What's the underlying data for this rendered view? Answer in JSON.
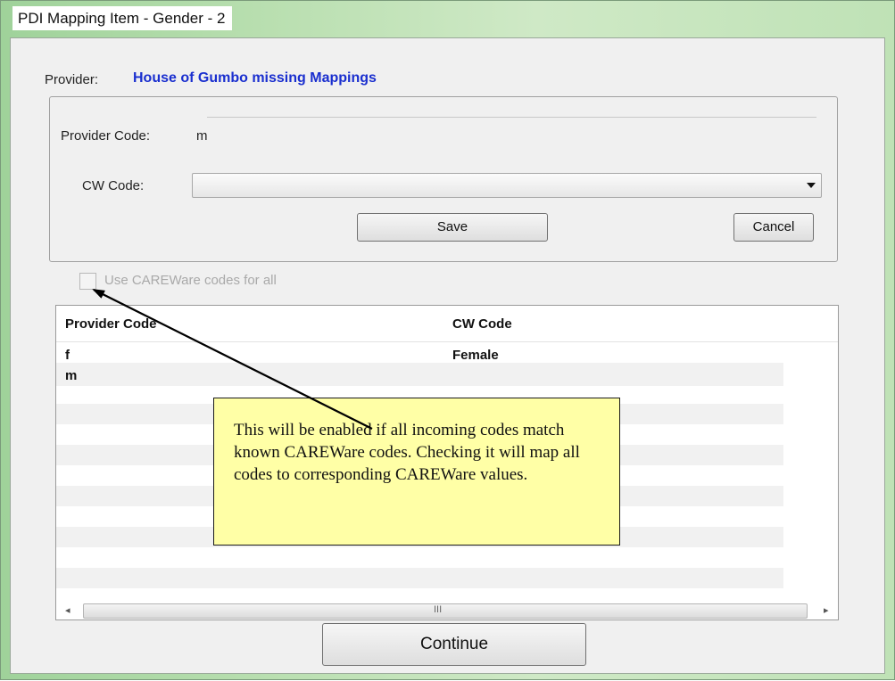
{
  "window": {
    "title": "PDI Mapping Item - Gender - 2"
  },
  "provider": {
    "label": "Provider:",
    "name": "House of Gumbo missing Mappings"
  },
  "form": {
    "provider_code_label": "Provider Code:",
    "provider_code_value": "m",
    "cw_code_label": "CW Code:",
    "cw_code_value": "",
    "save_label": "Save",
    "cancel_label": "Cancel"
  },
  "use_careware_checkbox": {
    "label": "Use CAREWare codes for all",
    "checked": false,
    "enabled": false
  },
  "grid": {
    "columns": [
      "Provider Code",
      "CW Code"
    ],
    "rows": [
      {
        "provider_code": "f",
        "cw_code": "Female"
      },
      {
        "provider_code": "m",
        "cw_code": ""
      }
    ],
    "scroll_grip": "III"
  },
  "callout": {
    "text": "This will be enabled if all incoming codes match known CAREWare codes. Checking it will map all codes to corresponding CAREWare values."
  },
  "continue_label": "Continue",
  "colors": {
    "provider_name": "#1a2fcf",
    "callout_bg": "#ffffa6"
  }
}
